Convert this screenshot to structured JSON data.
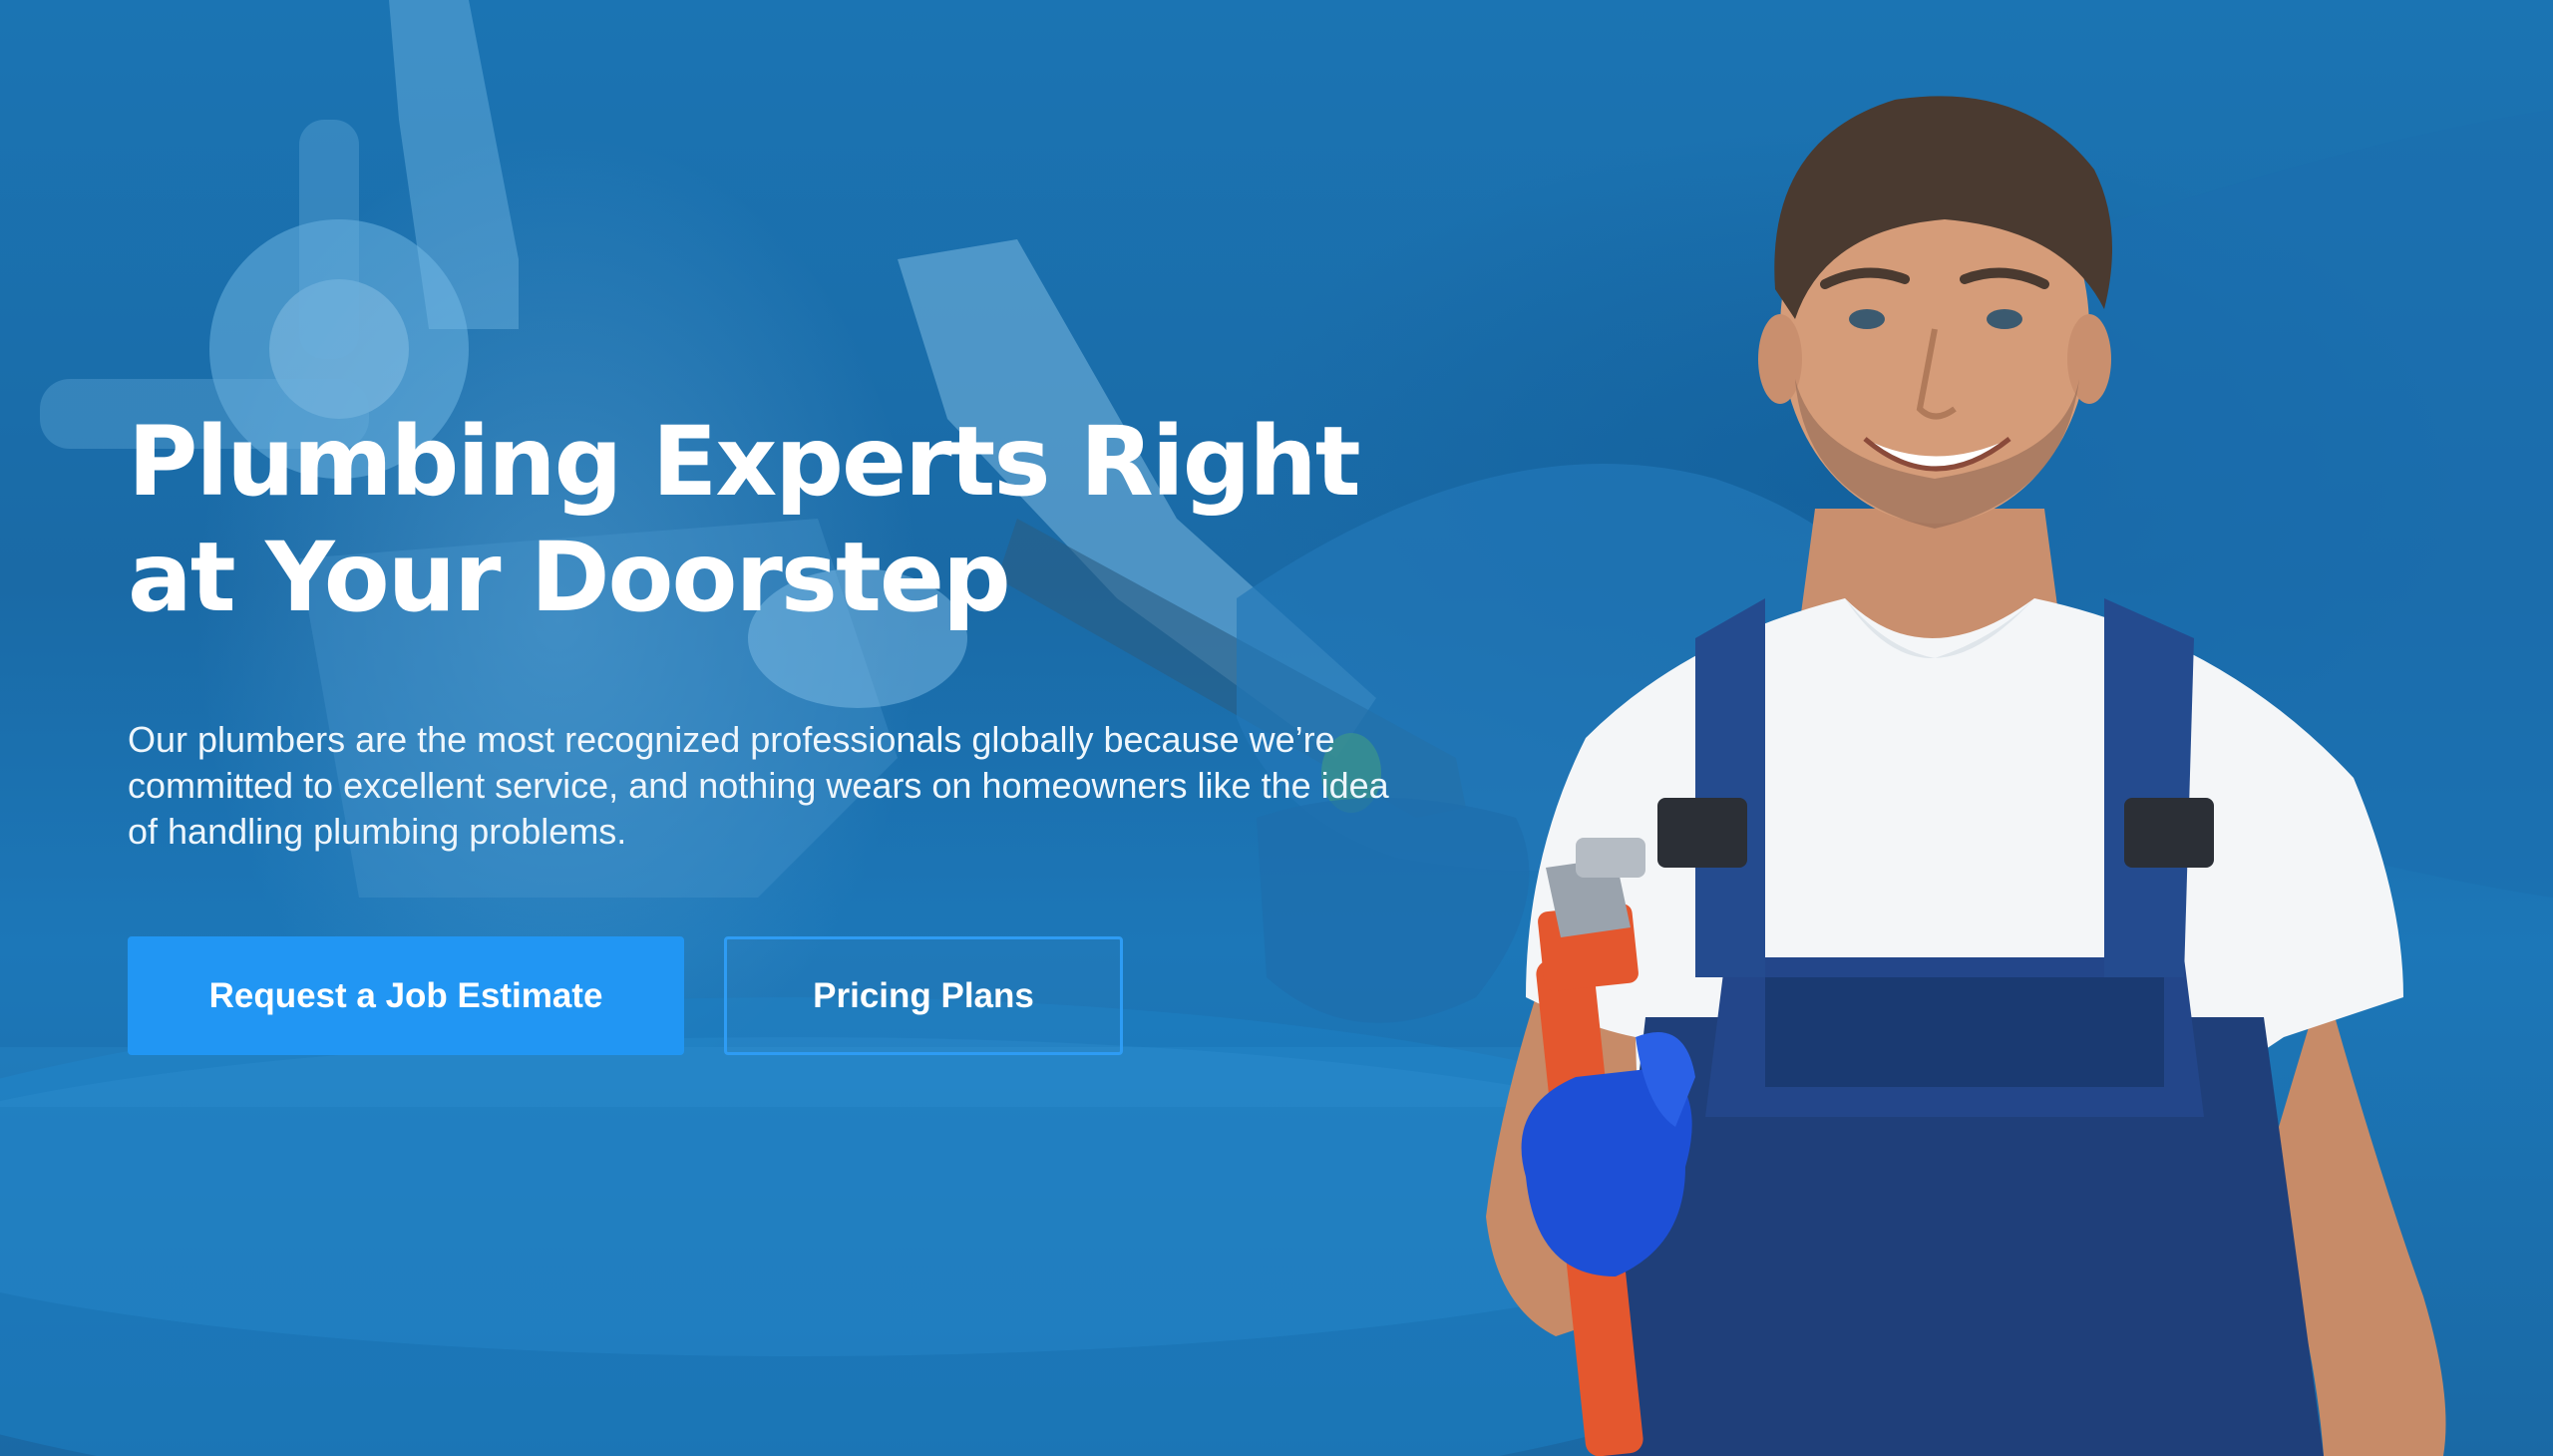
{
  "hero": {
    "headline": "Plumbing Experts Right at Your Doorstep",
    "description": "Our plumbers are the most recognized professionals globally because we’re committed to excellent service, and nothing wears on homeowners like the idea of handling plumbing problems.",
    "primary_button_label": "Request a Job Estimate",
    "secondary_button_label": "Pricing Plans",
    "image": "plumber-with-wrench-photo",
    "background_image": "faucet-repair-photo"
  },
  "colors": {
    "overlay": "#1a6fae",
    "primary_button": "#2196f3",
    "outline_button_border": "#2e9cf4",
    "text": "#ffffff"
  }
}
